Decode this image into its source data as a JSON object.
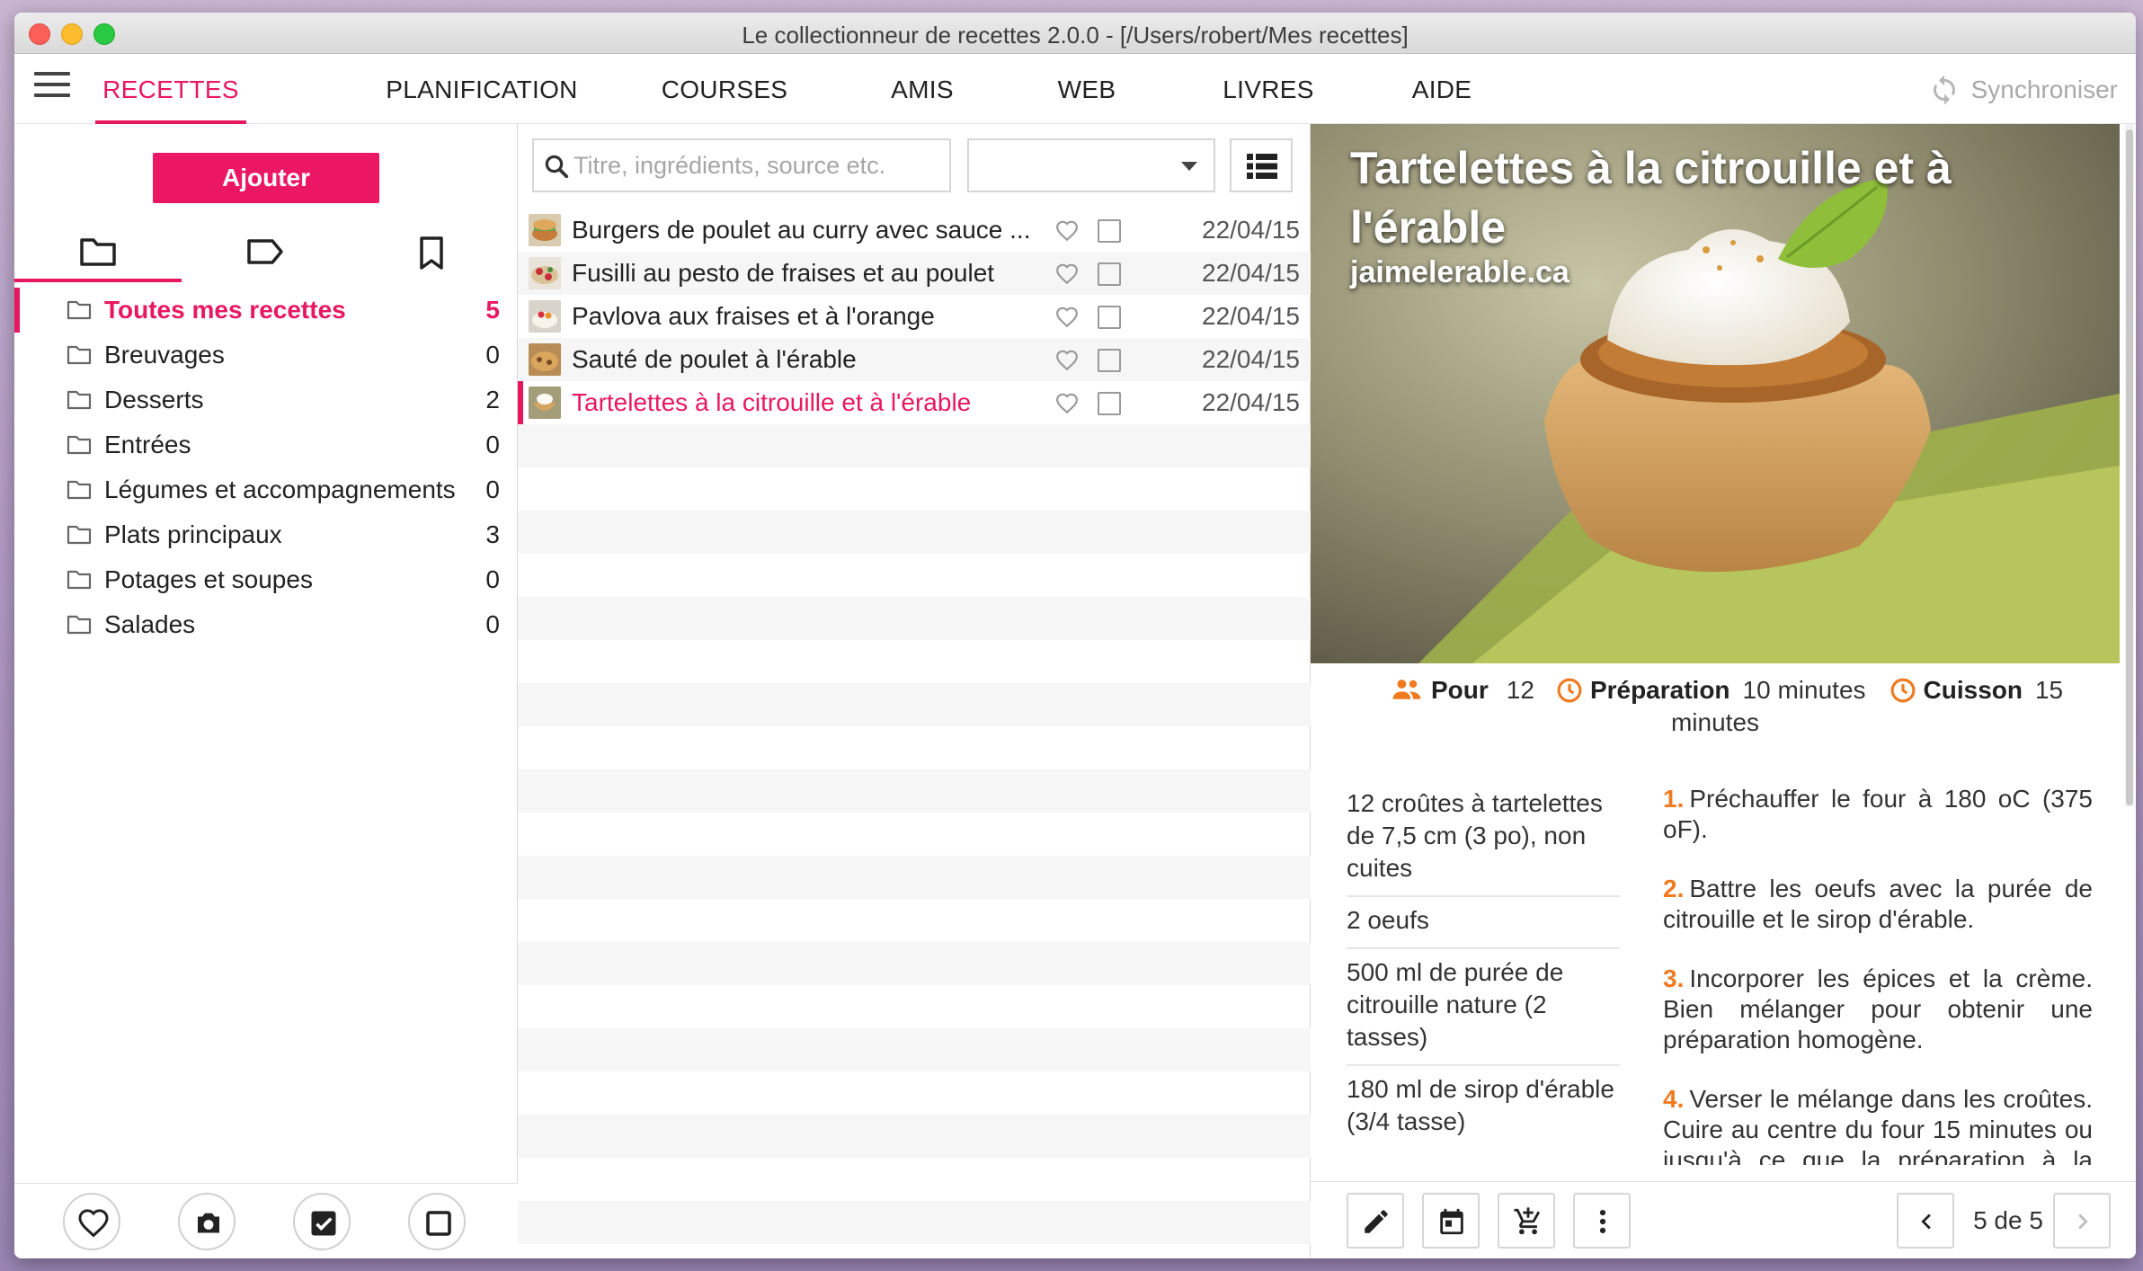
{
  "window": {
    "title": "Le collectionneur de recettes 2.0.0 -  [/Users/robert/Mes recettes]"
  },
  "menu": {
    "tabs": [
      {
        "label": "RECETTES",
        "active": true
      },
      {
        "label": "PLANIFICATION"
      },
      {
        "label": "COURSES"
      },
      {
        "label": "AMIS"
      },
      {
        "label": "WEB"
      },
      {
        "label": "LIVRES"
      },
      {
        "label": "AIDE"
      }
    ],
    "sync_label": "Synchroniser"
  },
  "left": {
    "add_label": "Ajouter",
    "view_tabs": [
      "folder-icon",
      "tag-icon",
      "bookmark-icon"
    ],
    "categories": [
      {
        "name": "Toutes mes recettes",
        "count": "5",
        "selected": true
      },
      {
        "name": "Breuvages",
        "count": "0"
      },
      {
        "name": "Desserts",
        "count": "2"
      },
      {
        "name": "Entrées",
        "count": "0"
      },
      {
        "name": "Légumes et accompagnements",
        "count": "0"
      },
      {
        "name": "Plats principaux",
        "count": "3"
      },
      {
        "name": "Potages et soupes",
        "count": "0"
      },
      {
        "name": "Salades",
        "count": "0"
      }
    ],
    "bottom_buttons": [
      "heart-icon",
      "camera-icon",
      "checked-box-icon",
      "empty-box-icon"
    ]
  },
  "middle": {
    "search_placeholder": "Titre, ingrédients, source etc.",
    "filter_value": "",
    "recipes": [
      {
        "name": "Burgers de poulet au curry avec sauce ...",
        "date": "22/04/15"
      },
      {
        "name": "Fusilli au pesto de fraises et au poulet",
        "date": "22/04/15"
      },
      {
        "name": "Pavlova aux fraises et à l'orange",
        "date": "22/04/15"
      },
      {
        "name": "Sauté de poulet à l'érable",
        "date": "22/04/15"
      },
      {
        "name": "Tartelettes à la citrouille et à l'érable",
        "date": "22/04/15",
        "selected": true
      }
    ]
  },
  "detail": {
    "title": "Tartelettes à la citrouille et à l'érable",
    "source": "jaimelerable.ca",
    "servings_label": "Pour",
    "servings_value": "12",
    "prep_label": "Préparation",
    "prep_value": "10 minutes",
    "cook_label": "Cuisson",
    "cook_value_1": "15",
    "cook_value_2": "minutes",
    "ingredients": [
      "12 croûtes à tartelettes de 7,5 cm (3 po), non cuites",
      "2 oeufs",
      "500 ml de purée de citrouille nature (2 tasses)",
      "180 ml de sirop d'érable (3/4 tasse)"
    ],
    "steps": [
      {
        "num": "1.",
        "text": "Préchauffer le four à 180 oC (375 oF)."
      },
      {
        "num": "2.",
        "text": "Battre les oeufs avec la purée de citrouille et le sirop d'érable."
      },
      {
        "num": "3.",
        "text": "Incorporer les épices et la crème. Bien mélanger pour obtenir une préparation homogène."
      },
      {
        "num": "4.",
        "text": "Verser le mélange dans les croûtes. Cuire au centre du four 15 minutes ou jusqu'à ce que la préparation à la citrouille soit ferme."
      }
    ],
    "toolbar": [
      "pencil-icon",
      "calendar-icon",
      "cart-add-icon",
      "more-vert-icon"
    ],
    "pager": "5 de 5"
  },
  "colors": {
    "accent": "#e8185f",
    "orange": "#f07a1f"
  }
}
